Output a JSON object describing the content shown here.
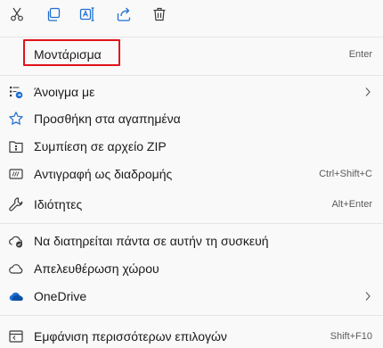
{
  "toolbar": {
    "buttons": [
      {
        "icon": "cut-icon"
      },
      {
        "icon": "copy-icon"
      },
      {
        "icon": "rename-icon"
      },
      {
        "icon": "share-icon"
      },
      {
        "icon": "delete-icon"
      }
    ]
  },
  "items": {
    "mount": {
      "label": "Μοντάρισμα",
      "shortcut": "Enter"
    },
    "open_with": {
      "label": "Άνοιγμα με",
      "icon": "open-with-icon"
    },
    "add_favorites": {
      "label": "Προσθήκη στα αγαπημένα",
      "icon": "star-icon"
    },
    "compress_zip": {
      "label": "Συμπίεση σε αρχείο ZIP",
      "icon": "zip-icon"
    },
    "copy_path": {
      "label": "Αντιγραφή ως διαδρομής",
      "shortcut": "Ctrl+Shift+C",
      "icon": "copy-path-icon"
    },
    "properties": {
      "label": "Ιδιότητες",
      "shortcut": "Alt+Enter",
      "icon": "wrench-icon"
    },
    "keep_on_device": {
      "label": "Να διατηρείται πάντα σε αυτήν τη συσκευή",
      "icon": "cloud-sync-icon"
    },
    "free_space": {
      "label": "Απελευθέρωση χώρου",
      "icon": "cloud-icon"
    },
    "onedrive": {
      "label": "OneDrive",
      "icon": "onedrive-icon"
    },
    "more_options": {
      "label": "Εμφάνιση περισσότερων επιλογών",
      "shortcut": "Shift+F10",
      "icon": "more-options-icon"
    }
  },
  "colors": {
    "highlight_border": "#e0141a",
    "icon_accent": "#1f6fd1",
    "menu_background": "#f9f9f9"
  }
}
